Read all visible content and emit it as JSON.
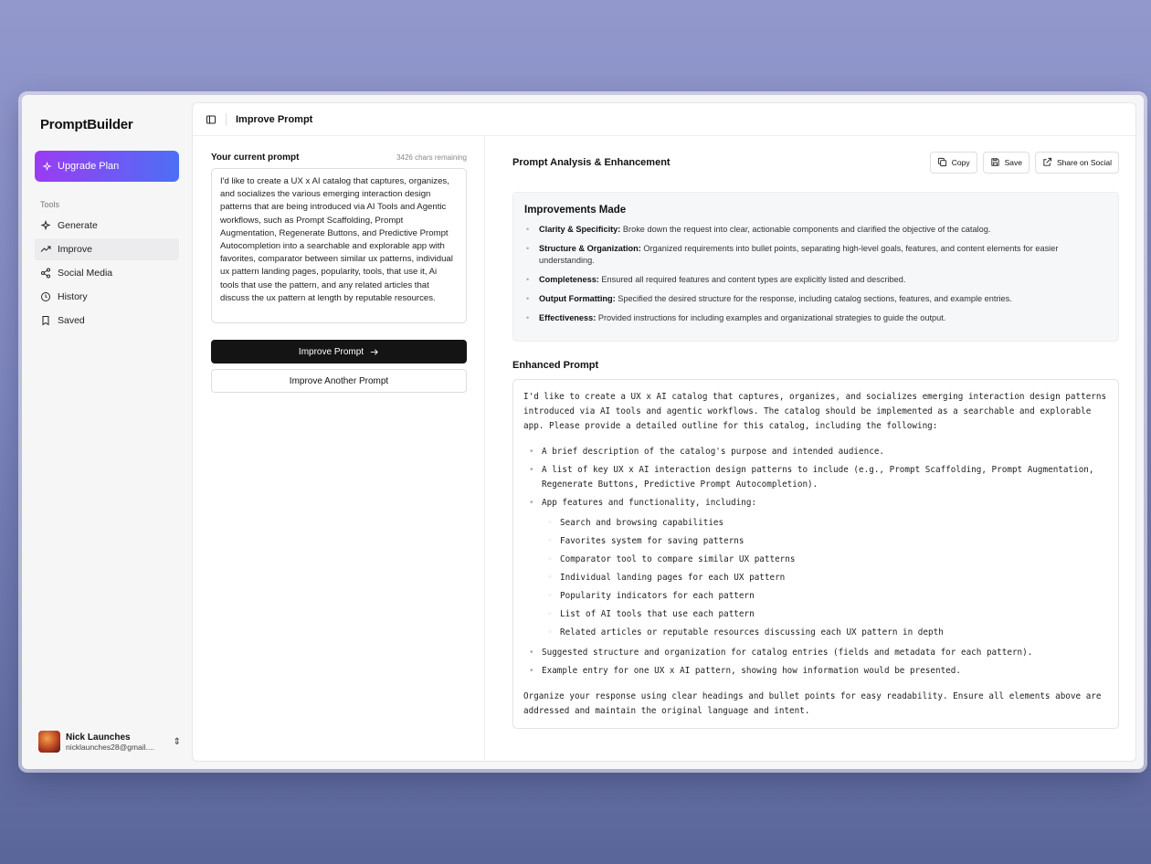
{
  "app": {
    "brand": "PromptBuilder",
    "upgrade_label": "Upgrade Plan"
  },
  "sidebar": {
    "section_label": "Tools",
    "items": [
      {
        "label": "Generate",
        "icon": "sparkle-icon"
      },
      {
        "label": "Improve",
        "icon": "trending-up-icon",
        "active": true
      },
      {
        "label": "Social Media",
        "icon": "share-icon"
      },
      {
        "label": "History",
        "icon": "clock-icon"
      },
      {
        "label": "Saved",
        "icon": "bookmark-icon"
      }
    ]
  },
  "user": {
    "name": "Nick Launches",
    "email": "nicklaunches28@gmail...."
  },
  "topbar": {
    "title": "Improve Prompt"
  },
  "prompt": {
    "label": "Your current prompt",
    "remaining": "3426 chars remaining",
    "text": "I'd like to create a UX x AI catalog that captures, organizes, and socializes the various emerging interaction design patterns that are being introduced via AI Tools and Agentic workflows, such as Prompt Scaffolding, Prompt Augmentation, Regenerate Buttons, and Predictive Prompt Autocompletion into a searchable and explorable app with favorites, comparator between similar ux patterns, individual ux pattern landing pages, popularity, tools, that use it, Ai tools that use the pattern, and any related articles that discuss the ux pattern at length by reputable resources.",
    "improve_button": "Improve Prompt",
    "another_button": "Improve Another Prompt"
  },
  "analysis": {
    "title": "Prompt Analysis & Enhancement",
    "actions": {
      "copy": "Copy",
      "save": "Save",
      "share": "Share on Social"
    },
    "improvements_title": "Improvements Made",
    "improvements": [
      {
        "term": "Clarity & Specificity:",
        "desc": " Broke down the request into clear, actionable components and clarified the objective of the catalog."
      },
      {
        "term": "Structure & Organization:",
        "desc": " Organized requirements into bullet points, separating high-level goals, features, and content elements for easier understanding."
      },
      {
        "term": "Completeness:",
        "desc": " Ensured all required features and content types are explicitly listed and described."
      },
      {
        "term": "Output Formatting:",
        "desc": " Specified the desired structure for the response, including catalog sections, features, and example entries."
      },
      {
        "term": "Effectiveness:",
        "desc": " Provided instructions for including examples and organizational strategies to guide the output."
      }
    ],
    "enhanced_title": "Enhanced Prompt",
    "enhanced": {
      "intro": "I'd like to create a UX x AI catalog that captures, organizes, and socializes emerging interaction design patterns introduced via AI tools and agentic workflows. The catalog should be implemented as a searchable and explorable app. Please provide a detailed outline for this catalog, including the following:",
      "bullet1": "A brief description of the catalog's purpose and intended audience.",
      "bullet2": "A list of key UX x AI interaction design patterns to include (e.g., Prompt Scaffolding, Prompt Augmentation, Regenerate Buttons, Predictive Prompt Autocompletion).",
      "bullet3": "App features and functionality, including:",
      "sub": [
        "Search and browsing capabilities",
        "Favorites system for saving patterns",
        "Comparator tool to compare similar UX patterns",
        "Individual landing pages for each UX pattern",
        "Popularity indicators for each pattern",
        "List of AI tools that use each pattern",
        "Related articles or reputable resources discussing each UX pattern in depth"
      ],
      "bullet4": "Suggested structure and organization for catalog entries (fields and metadata for each pattern).",
      "bullet5": "Example entry for one UX x AI pattern, showing how information would be presented.",
      "outro": "Organize your response using clear headings and bullet points for easy readability. Ensure all elements above are addressed and maintain the original language and intent."
    }
  }
}
